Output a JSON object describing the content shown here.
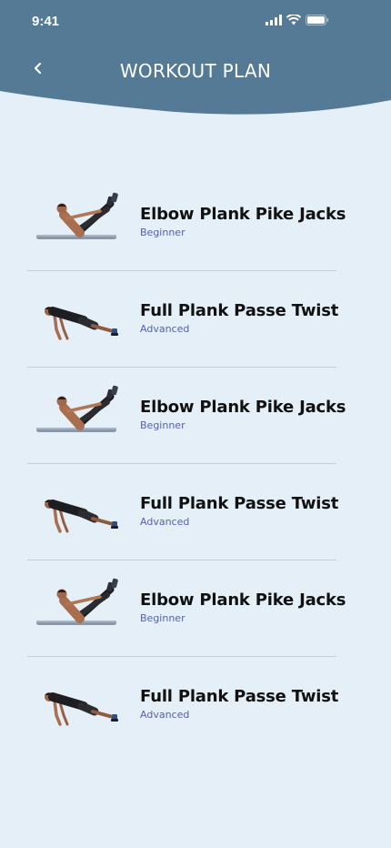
{
  "status": {
    "time": "9:41"
  },
  "header": {
    "title": "WORKOUT PLAN",
    "back_icon": "chevron-left-icon"
  },
  "colors": {
    "header": "#557a96",
    "background": "#e4eff8",
    "level": "#5560b8"
  },
  "workouts": [
    {
      "name": "Elbow Plank Pike Jacks",
      "level": "Beginner",
      "image": "v-sit-figure"
    },
    {
      "name": "Full Plank Passe Twist",
      "level": "Advanced",
      "image": "plank-figure"
    },
    {
      "name": "Elbow Plank Pike Jacks",
      "level": "Beginner",
      "image": "v-sit-figure"
    },
    {
      "name": "Full Plank Passe Twist",
      "level": "Advanced",
      "image": "plank-figure"
    },
    {
      "name": "Elbow Plank Pike Jacks",
      "level": "Beginner",
      "image": "v-sit-figure"
    },
    {
      "name": "Full Plank Passe Twist",
      "level": "Advanced",
      "image": "plank-figure"
    }
  ]
}
